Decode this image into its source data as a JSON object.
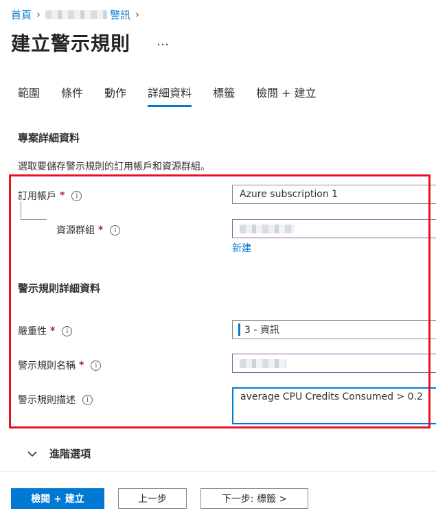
{
  "breadcrumb": {
    "home": "首頁",
    "current": "警訊"
  },
  "page": {
    "title": "建立警示規則",
    "more": "…"
  },
  "tabs": [
    {
      "label": "範圍"
    },
    {
      "label": "條件"
    },
    {
      "label": "動作"
    },
    {
      "label": "詳細資料",
      "active": true
    },
    {
      "label": "標籤"
    },
    {
      "label": "檢閱 + 建立"
    }
  ],
  "project": {
    "heading": "專案詳細資料",
    "description": "選取要儲存警示規則的訂用帳戶和資源群組。",
    "subscription": {
      "label": "訂用帳戶",
      "value": "Azure subscription 1"
    },
    "resource_group": {
      "label": "資源群組",
      "create_new": "新建"
    }
  },
  "alert_rule": {
    "heading": "警示規則詳細資料",
    "severity": {
      "label": "嚴重性",
      "value": "3 - 資訊"
    },
    "name": {
      "label": "警示規則名稱"
    },
    "description": {
      "label": "警示規則描述",
      "value": "average CPU Credits Consumed > 0.2"
    }
  },
  "advanced": {
    "label": "進階選項"
  },
  "footer": {
    "review_create": "檢閱 + 建立",
    "previous": "上一步",
    "next": "下一步: 標籤 >"
  },
  "colors": {
    "accent": "#0078d4",
    "required": "#a4262c",
    "highlight_box": "#e81123"
  }
}
